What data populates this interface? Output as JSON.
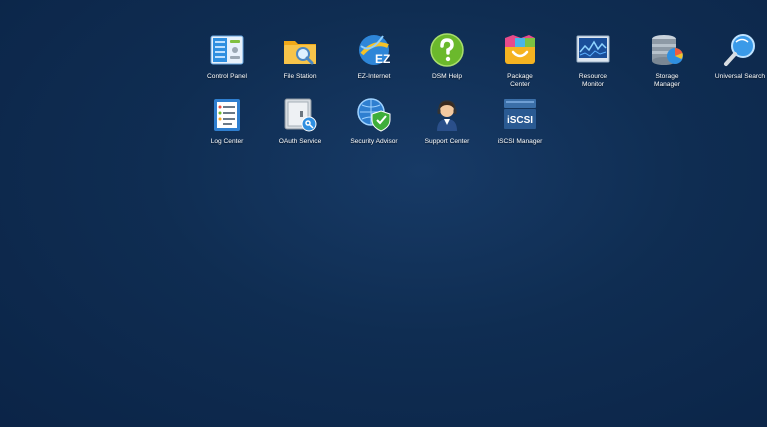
{
  "desktop": {
    "apps": [
      {
        "id": "control-panel",
        "label": "Control Panel",
        "icon": "control-panel-icon"
      },
      {
        "id": "file-station",
        "label": "File Station",
        "icon": "folder-search-icon"
      },
      {
        "id": "ez-internet",
        "label": "EZ-Internet",
        "icon": "ez-globe-icon"
      },
      {
        "id": "dsm-help",
        "label": "DSM Help",
        "icon": "question-mark-icon"
      },
      {
        "id": "package-center",
        "label": "Package\nCenter",
        "icon": "package-bag-icon"
      },
      {
        "id": "resource-monitor",
        "label": "Resource\nMonitor",
        "icon": "monitor-graph-icon"
      },
      {
        "id": "storage-manager",
        "label": "Storage\nManager",
        "icon": "database-pie-icon"
      },
      {
        "id": "universal-search",
        "label": "Universal Search",
        "icon": "magnifier-icon"
      },
      {
        "id": "log-center",
        "label": "Log Center",
        "icon": "log-clipboard-icon"
      },
      {
        "id": "oauth-service",
        "label": "OAuth Service",
        "icon": "safe-key-icon"
      },
      {
        "id": "security-advisor",
        "label": "Security Advisor",
        "icon": "globe-shield-icon"
      },
      {
        "id": "support-center",
        "label": "Support Center",
        "icon": "support-person-icon"
      },
      {
        "id": "iscsi-manager",
        "label": "iSCSI Manager",
        "icon": "iscsi-server-icon"
      }
    ],
    "icon_text": {
      "ez": "EZ",
      "iscsi": "iSCSI"
    }
  }
}
